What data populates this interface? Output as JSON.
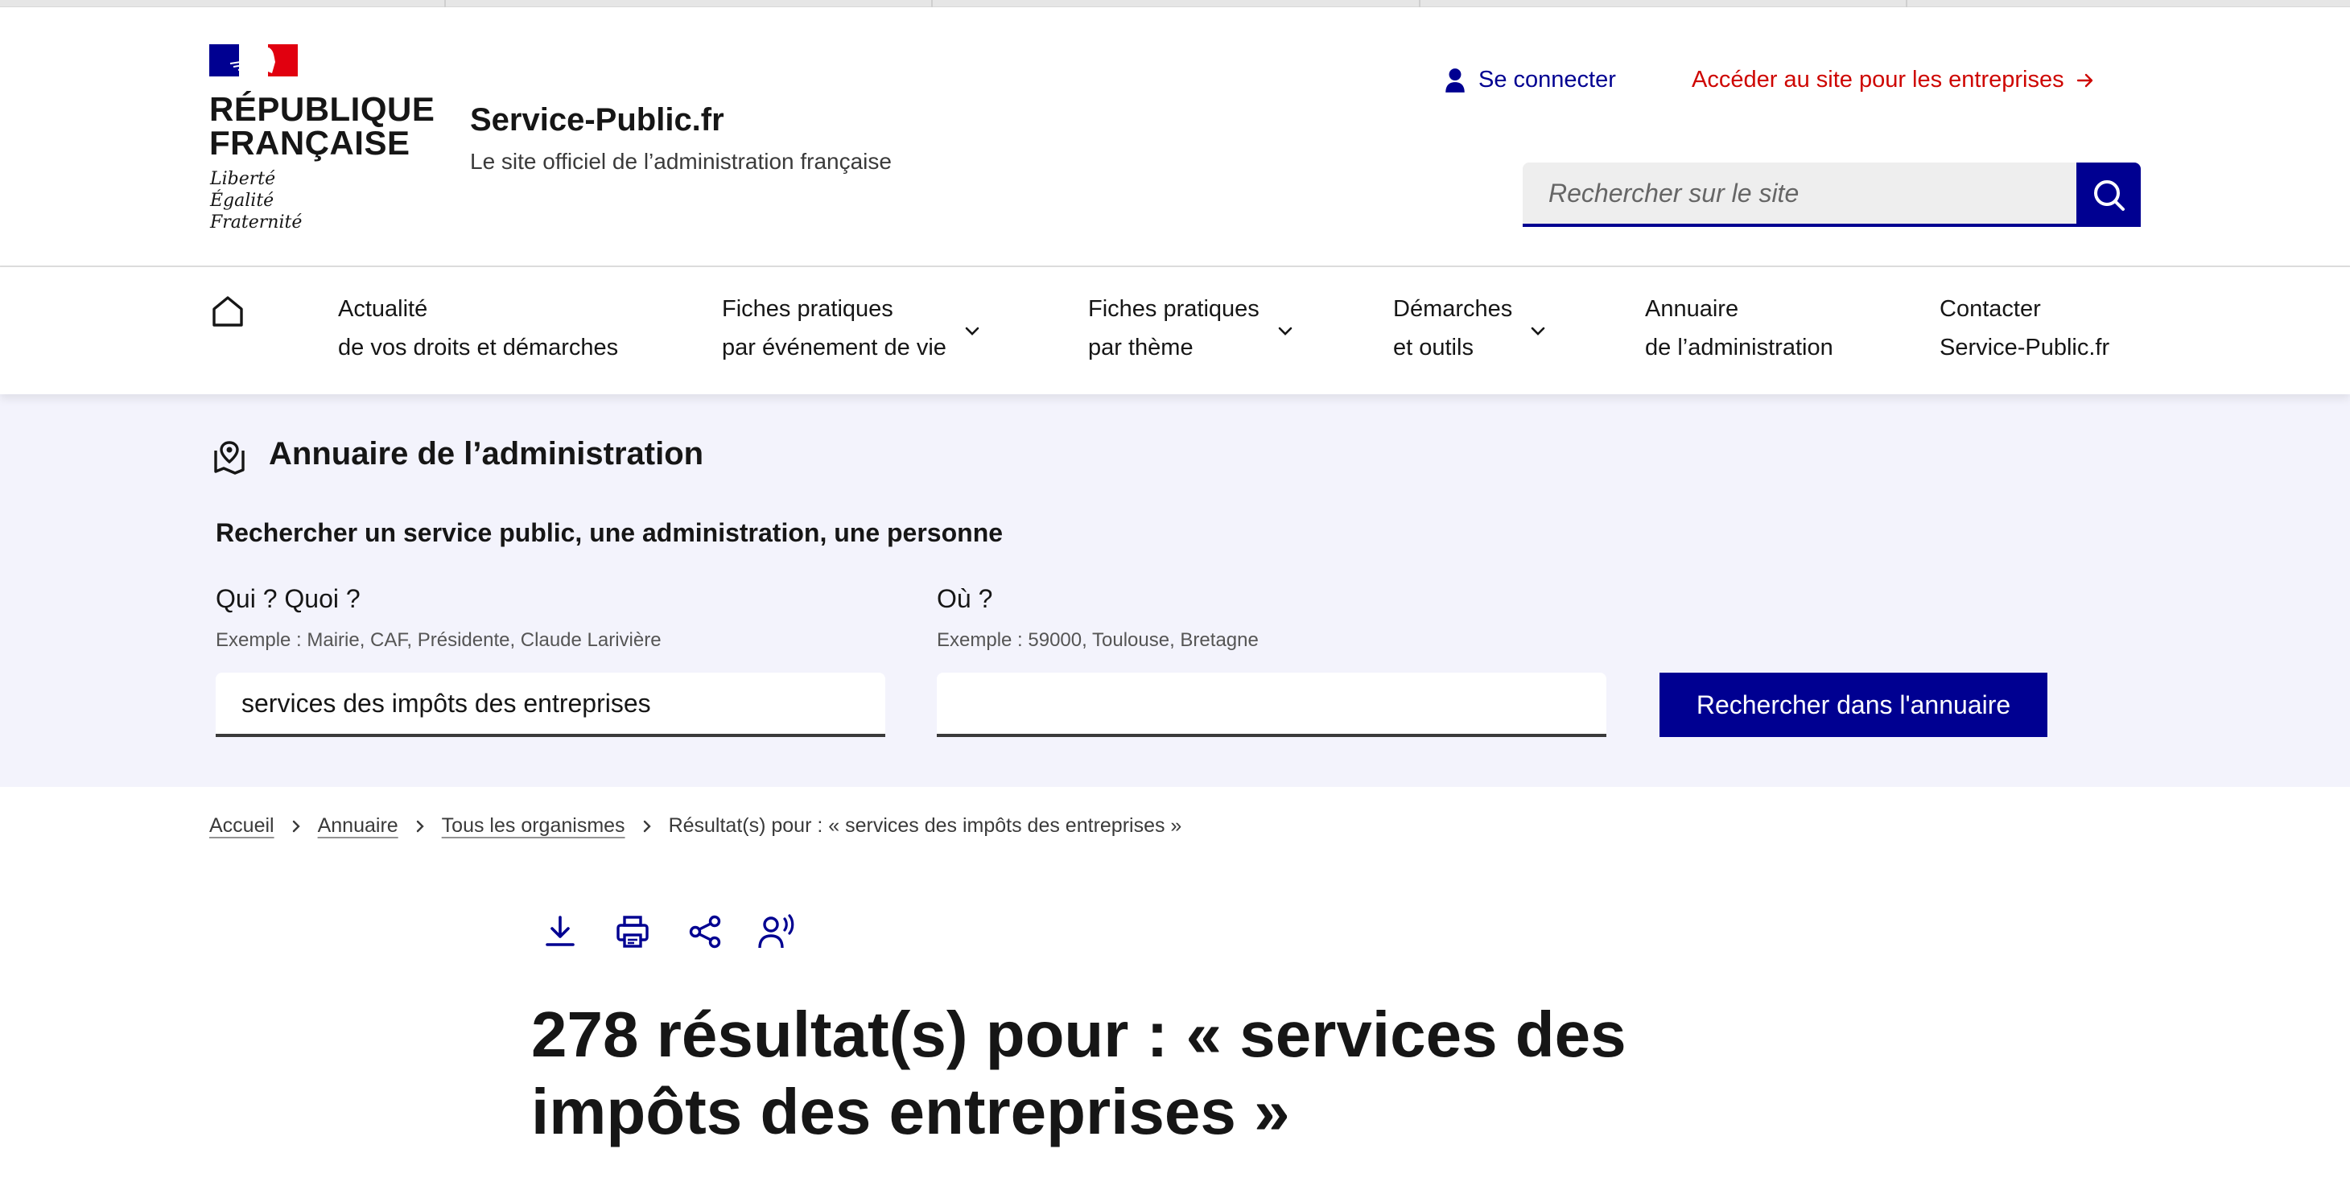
{
  "header": {
    "republic_line1": "RÉPUBLIQUE",
    "republic_line2": "FRANÇAISE",
    "motto_1": "Liberté",
    "motto_2": "Égalité",
    "motto_3": "Fraternité",
    "site_name": "Service-Public.fr",
    "site_tagline": "Le site officiel de l’administration française",
    "login_label": "Se connecter",
    "business_link": "Accéder au site pour les entreprises",
    "search_placeholder": "Rechercher sur le site"
  },
  "nav": {
    "items": [
      {
        "line1": "Actualité",
        "line2": "de vos droits et démarches"
      },
      {
        "line1": "Fiches pratiques",
        "line2": "par événement de vie"
      },
      {
        "line1": "Fiches pratiques",
        "line2": "par thème"
      },
      {
        "line1": "Démarches",
        "line2": "et outils"
      },
      {
        "line1": "Annuaire",
        "line2": "de l’administration"
      },
      {
        "line1": "Contacter",
        "line2": "Service-Public.fr"
      }
    ]
  },
  "annuaire": {
    "title": "Annuaire de l’administration",
    "subtitle": "Rechercher un service public, une administration, une personne",
    "what_label": "Qui ? Quoi ?",
    "what_hint": "Exemple : Mairie, CAF, Présidente, Claude Larivière",
    "what_value": "services des impôts des entreprises",
    "where_label": "Où ?",
    "where_hint": "Exemple : 59000, Toulouse, Bretagne",
    "where_value": "",
    "submit_label": "Rechercher dans l'annuaire"
  },
  "breadcrumb": {
    "items": [
      "Accueil",
      "Annuaire",
      "Tous les organismes"
    ],
    "current": "Résultat(s) pour : « services des impôts des entreprises »"
  },
  "results": {
    "count_text": "278 résultat(s)",
    "middle_text": " pour : ",
    "query_text": "« services des impôts des entreprises »"
  },
  "colors": {
    "primary_blue": "#000091",
    "accent_red": "#ce0500",
    "band_background": "#f3f3fc"
  }
}
